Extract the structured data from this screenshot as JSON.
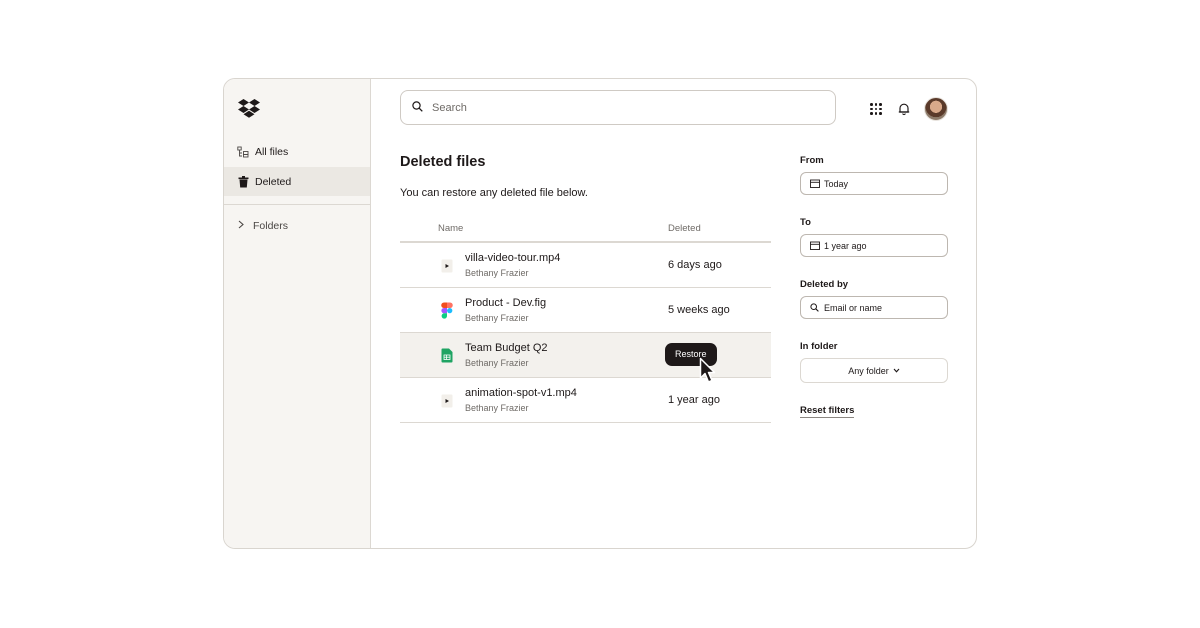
{
  "sidebar": {
    "logo_icon": "dropbox-logo-icon",
    "items": [
      {
        "label": "All files",
        "icon": "all-files-icon",
        "active": false
      },
      {
        "label": "Deleted",
        "icon": "trash-icon",
        "active": true
      }
    ],
    "folders_label": "Folders"
  },
  "header": {
    "search_placeholder": "Search",
    "icons": [
      "search-icon",
      "apps-grid-icon",
      "bell-icon",
      "avatar"
    ]
  },
  "main": {
    "title": "Deleted files",
    "subtitle": "You can restore any deleted file below.",
    "table": {
      "columns": [
        "Name",
        "Deleted"
      ],
      "rows": [
        {
          "name": "villa-video-tour.mp4",
          "owner": "Bethany Frazier",
          "deleted": "6 days ago",
          "icon": "video-file-icon"
        },
        {
          "name": "Product - Dev.fig",
          "owner": "Bethany Frazier",
          "deleted": "5 weeks ago",
          "icon": "figma-file-icon"
        },
        {
          "name": "Team Budget Q2",
          "owner": "Bethany Frazier",
          "deleted": "",
          "icon": "sheets-file-icon",
          "hovered": true
        },
        {
          "name": "animation-spot-v1.mp4",
          "owner": "Bethany Frazier",
          "deleted": "1 year ago",
          "icon": "video-file-icon"
        }
      ],
      "restore_label": "Restore"
    }
  },
  "filters": {
    "from_label": "From",
    "from_value": "Today",
    "to_label": "To",
    "to_value": "1 year ago",
    "deleted_by_label": "Deleted by",
    "deleted_by_placeholder": "Email or name",
    "in_folder_label": "In folder",
    "in_folder_value": "Any folder",
    "reset_label": "Reset filters"
  },
  "colors": {
    "sidebar_bg": "#f7f5f2",
    "active_bg": "#ebe8e3",
    "text": "#1e1919",
    "muted": "#6f6b67",
    "restore_bg": "#1e1919",
    "sheets_green": "#1fa463"
  }
}
